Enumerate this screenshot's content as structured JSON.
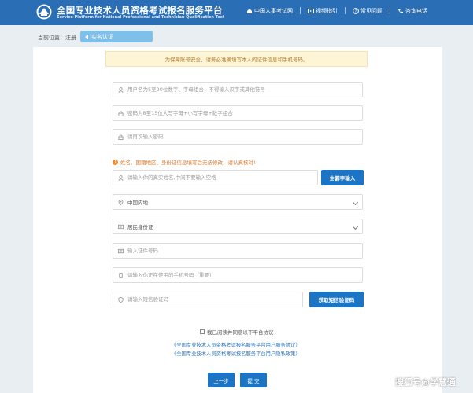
{
  "header": {
    "title": "全国专业技术人员资格考试报名服务平台",
    "subtitle": "Service Platform for National Professional and Technician Qualification Test",
    "nav": [
      {
        "label": "中国人事考试网",
        "icon": "home-icon"
      },
      {
        "label": "视频指引",
        "icon": "video-icon"
      },
      {
        "label": "常见问题",
        "icon": "question-icon"
      },
      {
        "label": "咨询电话",
        "icon": "phone-icon"
      }
    ]
  },
  "breadcrumb": {
    "label": "当前位置：注册",
    "chip": "实名认证"
  },
  "notice": "为保障账号安全，请务必准确填写本人的证件信息和手机号码。",
  "form": {
    "username_placeholder": "用户名为5至20位数字、字母组合，不得输入汉字或其他符号",
    "password_placeholder": "密码为8至15位大写字母+小写字母+数字组合",
    "password_confirm_placeholder": "请再次输入密码",
    "warning": "姓名、国籍地区、身份证信息填写后无法修改，请认真核对!",
    "name_placeholder": "请输入你的真实姓名,中间不要输入空格",
    "rare_char_button": "生僻字输入",
    "region_value": "中国内地",
    "id_type_value": "居民身份证",
    "id_number_placeholder": "输入证件号码",
    "phone_placeholder": "请输入你正在使用的手机号码（重要）",
    "sms_code_placeholder": "请输入短信验证码",
    "sms_button": "获取短信验证码"
  },
  "agreement": {
    "checkbox_label": "我已阅读并同意以下平台协议",
    "link_service": "《全国专业技术人员资格考试报名服务平台用户服务协议》",
    "link_privacy": "《全国专业技术人员资格考试报名服务平台用户隐私政策》"
  },
  "buttons": {
    "prev": "上一步",
    "submit": "提 交"
  },
  "watermark": "搜狐号@学慧通",
  "colors": {
    "header": "#2a6fb5",
    "button": "#1c74c5",
    "warning": "#e07a2b",
    "notice_bg": "#fdf5d6"
  }
}
